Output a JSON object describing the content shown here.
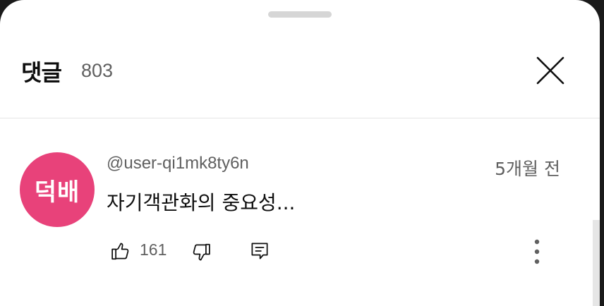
{
  "header": {
    "title": "댓글",
    "count": "803"
  },
  "comment": {
    "avatar_text": "덕배",
    "author": "@user-qi1mk8ty6n",
    "timestamp": "5개월 전",
    "text": "자기객관화의 중요성...",
    "like_count": "161"
  },
  "colors": {
    "avatar_bg": "#e8427a",
    "primary_text": "#0f0f0f",
    "secondary_text": "#606060"
  },
  "icons": {
    "close": "close-icon",
    "like": "thumbs-up-icon",
    "dislike": "thumbs-down-icon",
    "reply": "reply-icon",
    "more": "more-vertical-icon"
  }
}
